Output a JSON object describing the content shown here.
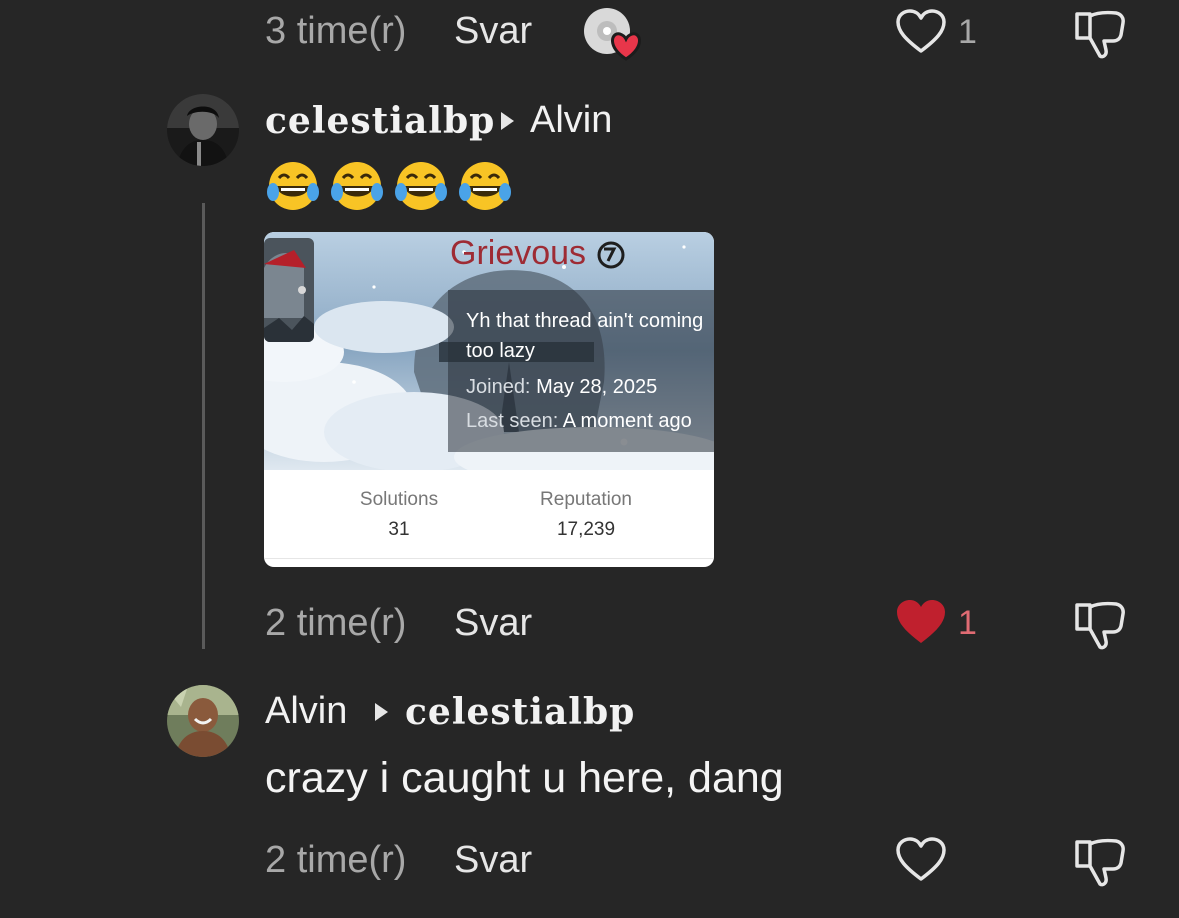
{
  "comments": [
    {
      "id": "top-partial",
      "time": "3 time(r)",
      "reply_label": "Svar",
      "like_count": "1",
      "liked": false,
      "has_creator_like": true
    },
    {
      "id": "celestialbp-reply",
      "author": "celestialbp",
      "reply_to": "Alvin",
      "text": "😂😂😂😂",
      "embed": {
        "profile_name": "Grievous",
        "status_line1": "Yh that thread ain't coming",
        "status_line2": "too lazy",
        "joined_label": "Joined:",
        "joined_value": "May 28, 2025",
        "last_seen_label": "Last seen:",
        "last_seen_value": "A moment ago",
        "stats": [
          {
            "label": "Solutions",
            "value": "31"
          },
          {
            "label": "Reputation",
            "value": "17,239"
          }
        ]
      },
      "time": "2 time(r)",
      "reply_label": "Svar",
      "like_count": "1",
      "liked": true
    },
    {
      "id": "alvin-reply",
      "author": "Alvin",
      "reply_to": "celestialbp",
      "text": "crazy i caught u here, dang",
      "time": "2 time(r)",
      "reply_label": "Svar",
      "like_count": "",
      "liked": false
    }
  ],
  "colors": {
    "background": "#262626",
    "liked_heart": "#c0202e",
    "liked_count": "#e06b73",
    "muted_text": "#a8a8a8",
    "thread_line": "#5a5a5a"
  },
  "icons": {
    "like": "heart-outline-icon",
    "liked": "heart-filled-icon",
    "dislike": "thumbs-down-icon",
    "creator_like": "creator-liked-badge-icon",
    "reply_caret": "play-caret-icon"
  }
}
